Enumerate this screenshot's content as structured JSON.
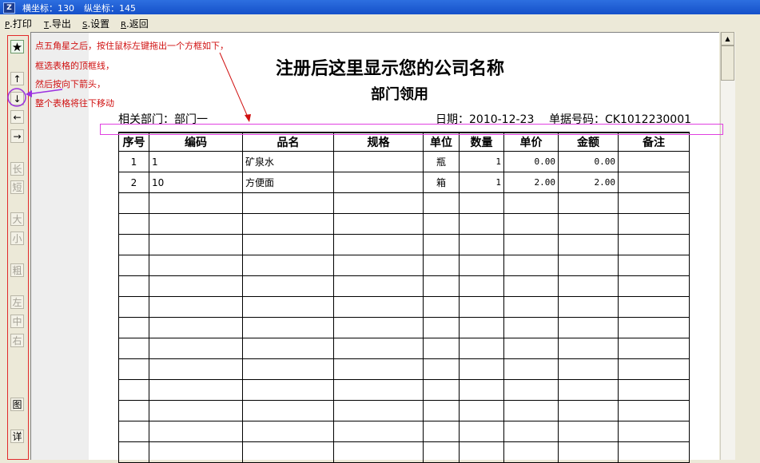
{
  "titlebar": {
    "icon": "Z",
    "x_label": "横坐标：130",
    "y_label": "纵坐标：145"
  },
  "menu": [
    {
      "key": "P",
      "label": ".打印"
    },
    {
      "key": "T",
      "label": ".导出"
    },
    {
      "key": "S",
      "label": ".设置"
    },
    {
      "key": "R",
      "label": ".返回"
    }
  ],
  "toolbar": {
    "star": "★",
    "up": "↑",
    "down": "↓",
    "left": "←",
    "right": "→",
    "longer": "长",
    "shorter": "短",
    "bigger": "大",
    "smaller": "小",
    "bold": "粗",
    "align_left": "左",
    "align_center": "中",
    "align_right": "右",
    "image": "图",
    "detail": "详"
  },
  "annotations": {
    "line1": "点五角星之后，按住鼠标左键拖出一个方框如下，",
    "line2": "框选表格的顶框线，",
    "line3": "然后按向下箭头，",
    "line4": "整个表格将往下移动"
  },
  "document": {
    "company": "注册后这里显示您的公司名称",
    "title": "部门领用",
    "dept_label": "相关部门：",
    "dept_value": "部门一",
    "date_label": "日期：",
    "date_value": "2010-12-23",
    "no_label": "单据号码：",
    "no_value": "CK1012230001"
  },
  "table": {
    "headers": [
      "序号",
      "编码",
      "品名",
      "规格",
      "单位",
      "数量",
      "单价",
      "金额",
      "备注"
    ],
    "rows": [
      [
        "1",
        "1",
        "矿泉水",
        "",
        "瓶",
        "1",
        "0.00",
        "0.00",
        ""
      ],
      [
        "2",
        "10",
        "方便面",
        "",
        "箱",
        "1",
        "2.00",
        "2.00",
        ""
      ]
    ],
    "empty_rows": 13
  },
  "colors": {
    "annotation": "#d01010",
    "selection": "#e040e0",
    "titlebar": "#1f5fd6"
  }
}
